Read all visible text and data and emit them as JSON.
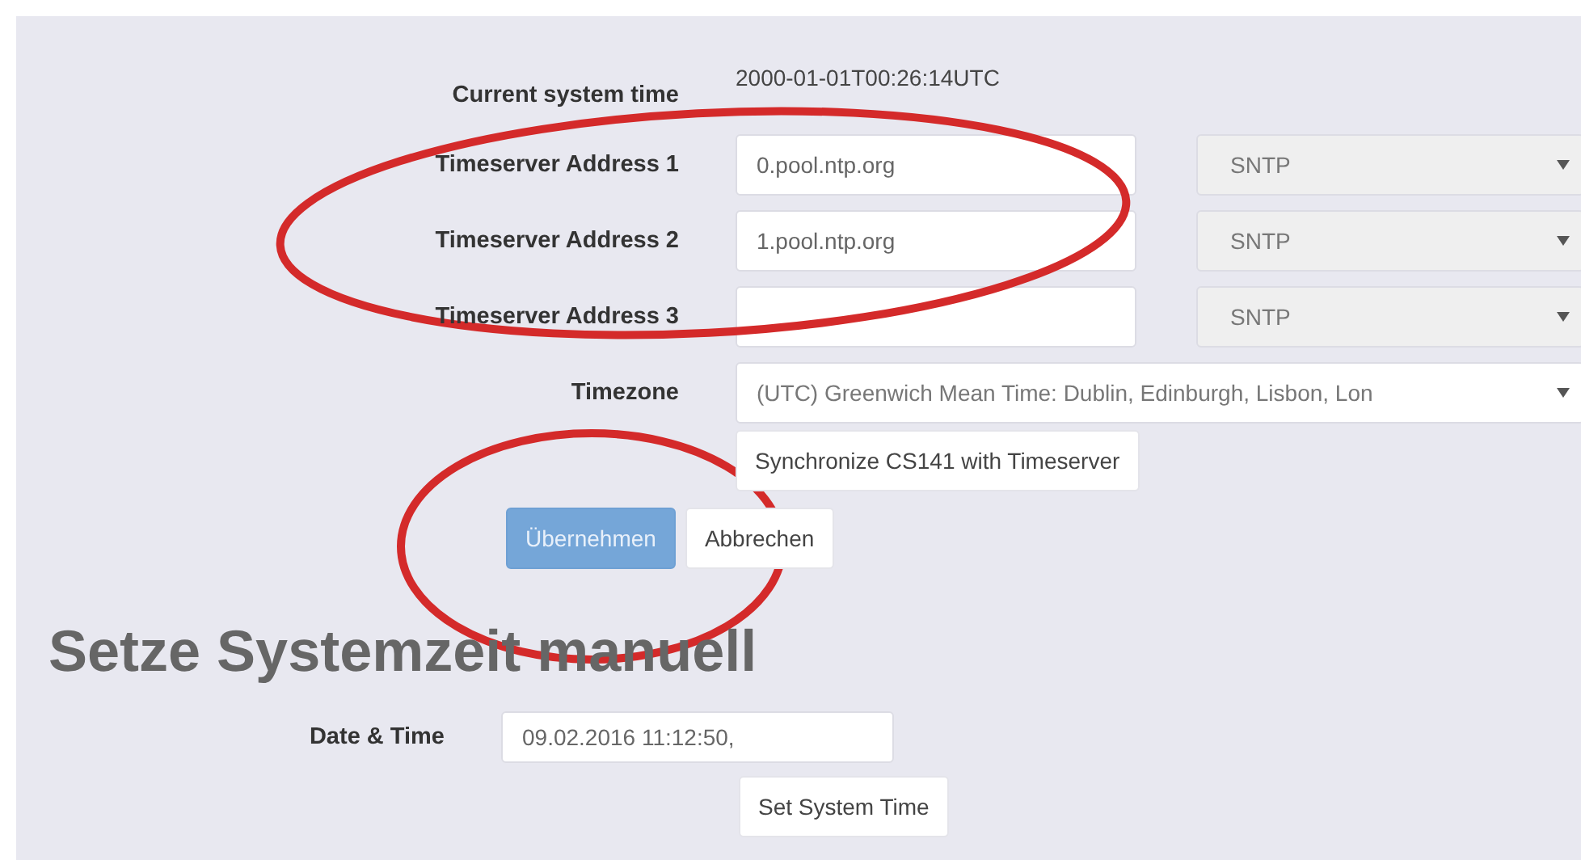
{
  "current_time": {
    "label": "Current system time",
    "value": "2000-01-01T00:26:14UTC"
  },
  "timeservers": [
    {
      "label": "Timeserver Address 1",
      "value": "0.pool.ntp.org",
      "protocol": "SNTP"
    },
    {
      "label": "Timeserver Address 2",
      "value": "1.pool.ntp.org",
      "protocol": "SNTP"
    },
    {
      "label": "Timeserver Address 3",
      "protocol": "SNTP"
    }
  ],
  "timezone": {
    "label": "Timezone",
    "value": "(UTC) Greenwich Mean Time: Dublin, Edinburgh, Lisbon, Lon"
  },
  "sync_button": "Synchronize CS141 with Timeserver",
  "buttons": [
    {
      "label": "Übernehmen",
      "kind": "primary"
    },
    {
      "label": "Abbrechen",
      "kind": "default"
    }
  ],
  "manual": {
    "heading": "Setze Systemzeit manuell",
    "label": "Date & Time",
    "value": "09.02.2016 11:12:50,",
    "button": "Set System Time"
  },
  "annotations": [
    {
      "kind": "ellipse"
    },
    {
      "kind": "ellipse"
    }
  ]
}
